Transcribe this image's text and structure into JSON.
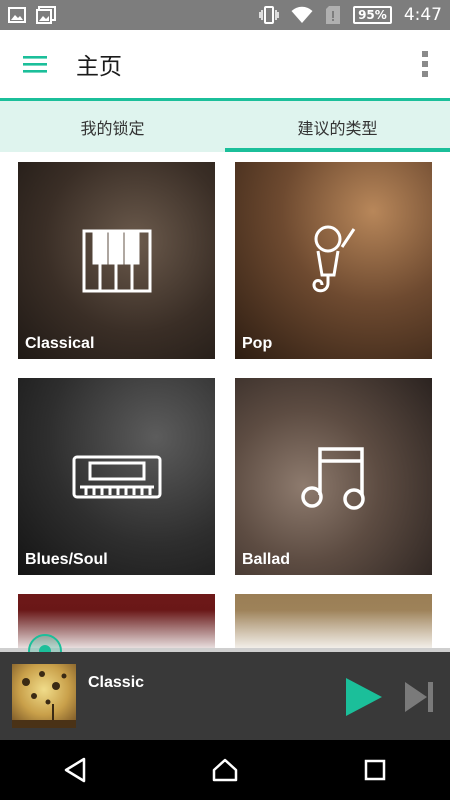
{
  "status_bar": {
    "battery_percent": "95%",
    "time": "4:47"
  },
  "app_bar": {
    "title": "主页"
  },
  "tabs": [
    {
      "label": "我的锁定"
    },
    {
      "label": "建议的类型"
    }
  ],
  "genres": [
    {
      "label": "Classical",
      "icon": "piano-keys-icon"
    },
    {
      "label": "Pop",
      "icon": "microphone-icon"
    },
    {
      "label": "Blues/Soul",
      "icon": "harmonica-icon"
    },
    {
      "label": "Ballad",
      "icon": "music-note-icon"
    }
  ],
  "player": {
    "track_title": "Classic",
    "progress": 0.03
  },
  "colors": {
    "accent": "#1bbf9a",
    "status_bar": "#7d7d7d",
    "player_bg": "#393939",
    "tab_bg": "#dff4ee"
  }
}
